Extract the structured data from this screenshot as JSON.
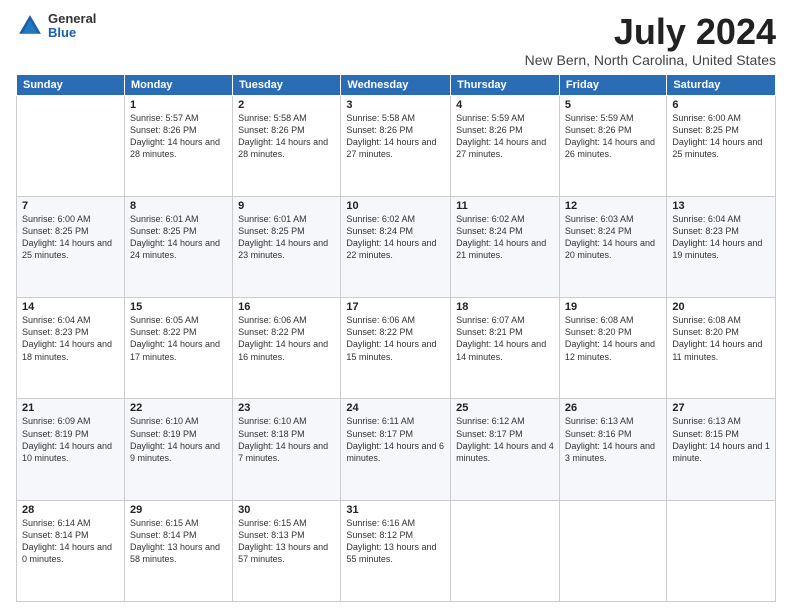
{
  "logo": {
    "general": "General",
    "blue": "Blue"
  },
  "title": {
    "month": "July 2024",
    "location": "New Bern, North Carolina, United States"
  },
  "headers": [
    "Sunday",
    "Monday",
    "Tuesday",
    "Wednesday",
    "Thursday",
    "Friday",
    "Saturday"
  ],
  "weeks": [
    [
      {
        "day": "",
        "text": ""
      },
      {
        "day": "1",
        "text": "Sunrise: 5:57 AM\nSunset: 8:26 PM\nDaylight: 14 hours and 28 minutes."
      },
      {
        "day": "2",
        "text": "Sunrise: 5:58 AM\nSunset: 8:26 PM\nDaylight: 14 hours and 28 minutes."
      },
      {
        "day": "3",
        "text": "Sunrise: 5:58 AM\nSunset: 8:26 PM\nDaylight: 14 hours and 27 minutes."
      },
      {
        "day": "4",
        "text": "Sunrise: 5:59 AM\nSunset: 8:26 PM\nDaylight: 14 hours and 27 minutes."
      },
      {
        "day": "5",
        "text": "Sunrise: 5:59 AM\nSunset: 8:26 PM\nDaylight: 14 hours and 26 minutes."
      },
      {
        "day": "6",
        "text": "Sunrise: 6:00 AM\nSunset: 8:25 PM\nDaylight: 14 hours and 25 minutes."
      }
    ],
    [
      {
        "day": "7",
        "text": "Sunrise: 6:00 AM\nSunset: 8:25 PM\nDaylight: 14 hours and 25 minutes."
      },
      {
        "day": "8",
        "text": "Sunrise: 6:01 AM\nSunset: 8:25 PM\nDaylight: 14 hours and 24 minutes."
      },
      {
        "day": "9",
        "text": "Sunrise: 6:01 AM\nSunset: 8:25 PM\nDaylight: 14 hours and 23 minutes."
      },
      {
        "day": "10",
        "text": "Sunrise: 6:02 AM\nSunset: 8:24 PM\nDaylight: 14 hours and 22 minutes."
      },
      {
        "day": "11",
        "text": "Sunrise: 6:02 AM\nSunset: 8:24 PM\nDaylight: 14 hours and 21 minutes."
      },
      {
        "day": "12",
        "text": "Sunrise: 6:03 AM\nSunset: 8:24 PM\nDaylight: 14 hours and 20 minutes."
      },
      {
        "day": "13",
        "text": "Sunrise: 6:04 AM\nSunset: 8:23 PM\nDaylight: 14 hours and 19 minutes."
      }
    ],
    [
      {
        "day": "14",
        "text": "Sunrise: 6:04 AM\nSunset: 8:23 PM\nDaylight: 14 hours and 18 minutes."
      },
      {
        "day": "15",
        "text": "Sunrise: 6:05 AM\nSunset: 8:22 PM\nDaylight: 14 hours and 17 minutes."
      },
      {
        "day": "16",
        "text": "Sunrise: 6:06 AM\nSunset: 8:22 PM\nDaylight: 14 hours and 16 minutes."
      },
      {
        "day": "17",
        "text": "Sunrise: 6:06 AM\nSunset: 8:22 PM\nDaylight: 14 hours and 15 minutes."
      },
      {
        "day": "18",
        "text": "Sunrise: 6:07 AM\nSunset: 8:21 PM\nDaylight: 14 hours and 14 minutes."
      },
      {
        "day": "19",
        "text": "Sunrise: 6:08 AM\nSunset: 8:20 PM\nDaylight: 14 hours and 12 minutes."
      },
      {
        "day": "20",
        "text": "Sunrise: 6:08 AM\nSunset: 8:20 PM\nDaylight: 14 hours and 11 minutes."
      }
    ],
    [
      {
        "day": "21",
        "text": "Sunrise: 6:09 AM\nSunset: 8:19 PM\nDaylight: 14 hours and 10 minutes."
      },
      {
        "day": "22",
        "text": "Sunrise: 6:10 AM\nSunset: 8:19 PM\nDaylight: 14 hours and 9 minutes."
      },
      {
        "day": "23",
        "text": "Sunrise: 6:10 AM\nSunset: 8:18 PM\nDaylight: 14 hours and 7 minutes."
      },
      {
        "day": "24",
        "text": "Sunrise: 6:11 AM\nSunset: 8:17 PM\nDaylight: 14 hours and 6 minutes."
      },
      {
        "day": "25",
        "text": "Sunrise: 6:12 AM\nSunset: 8:17 PM\nDaylight: 14 hours and 4 minutes."
      },
      {
        "day": "26",
        "text": "Sunrise: 6:13 AM\nSunset: 8:16 PM\nDaylight: 14 hours and 3 minutes."
      },
      {
        "day": "27",
        "text": "Sunrise: 6:13 AM\nSunset: 8:15 PM\nDaylight: 14 hours and 1 minute."
      }
    ],
    [
      {
        "day": "28",
        "text": "Sunrise: 6:14 AM\nSunset: 8:14 PM\nDaylight: 14 hours and 0 minutes."
      },
      {
        "day": "29",
        "text": "Sunrise: 6:15 AM\nSunset: 8:14 PM\nDaylight: 13 hours and 58 minutes."
      },
      {
        "day": "30",
        "text": "Sunrise: 6:15 AM\nSunset: 8:13 PM\nDaylight: 13 hours and 57 minutes."
      },
      {
        "day": "31",
        "text": "Sunrise: 6:16 AM\nSunset: 8:12 PM\nDaylight: 13 hours and 55 minutes."
      },
      {
        "day": "",
        "text": ""
      },
      {
        "day": "",
        "text": ""
      },
      {
        "day": "",
        "text": ""
      }
    ]
  ]
}
